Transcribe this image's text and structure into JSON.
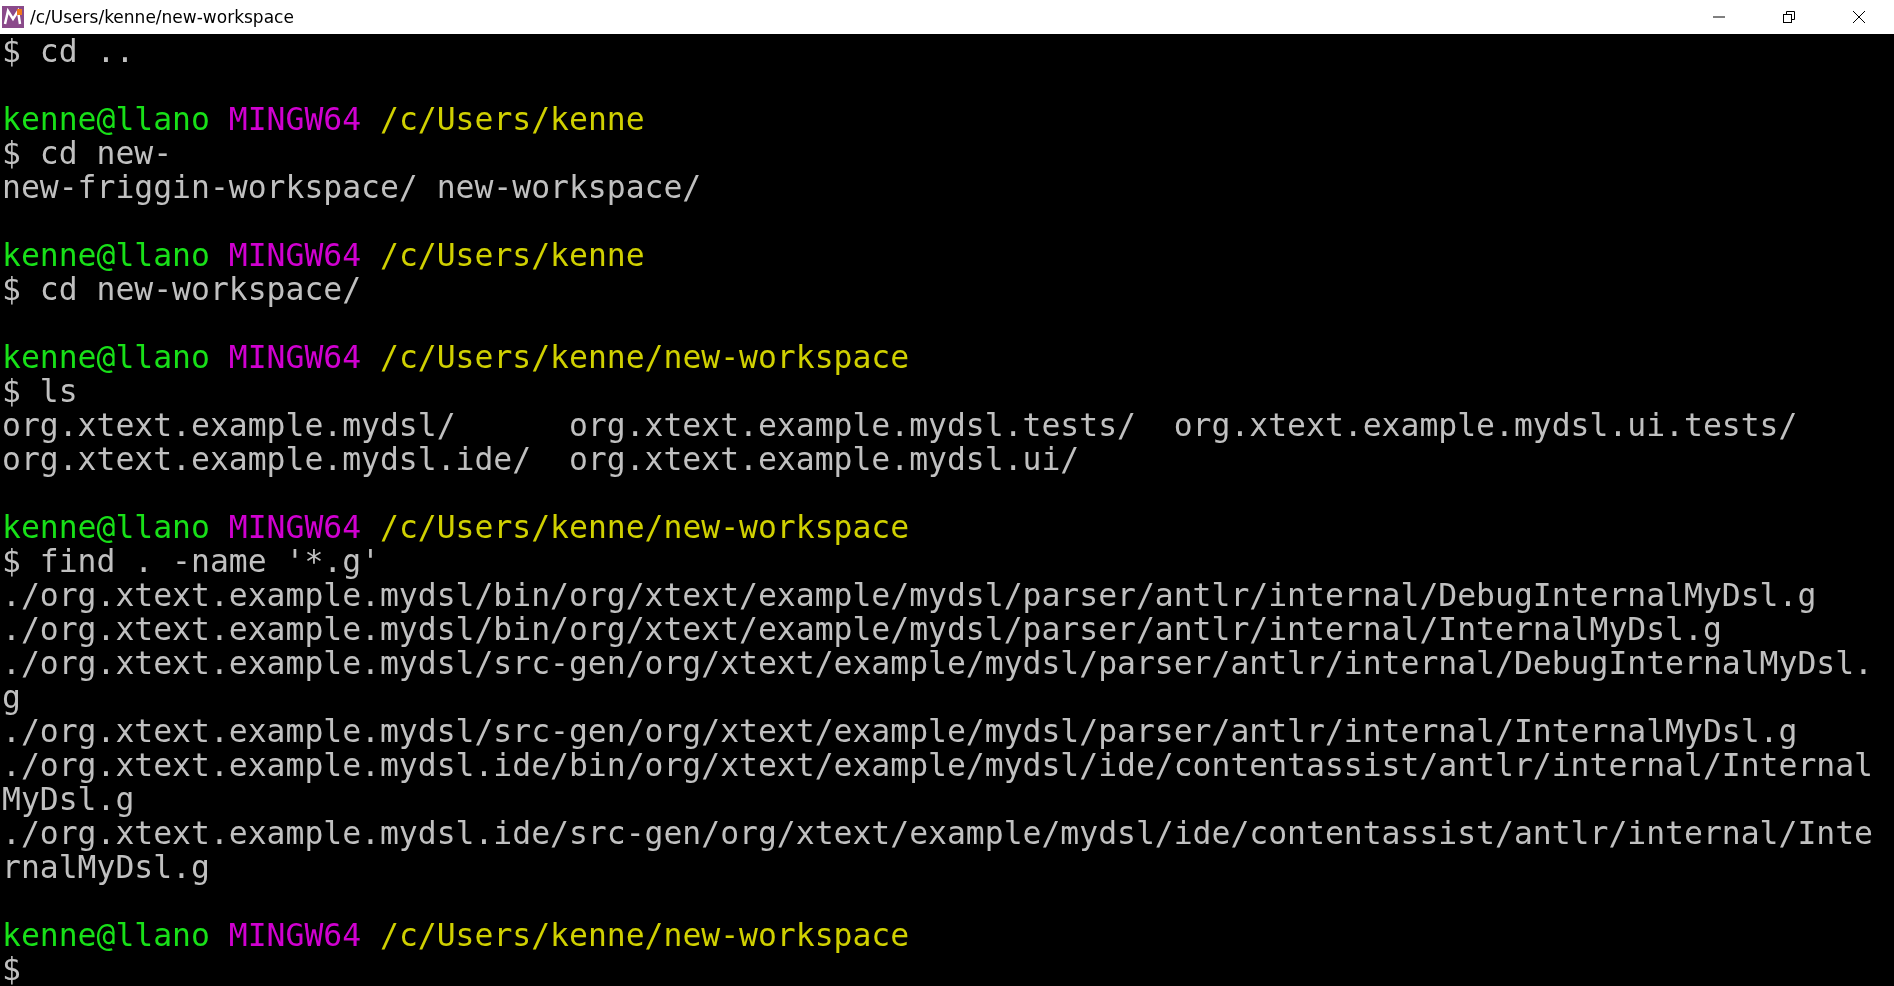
{
  "window": {
    "title": "/c/Users/kenne/new-workspace"
  },
  "lines": [
    {
      "kind": "text",
      "text": "$ cd .."
    },
    {
      "kind": "blank"
    },
    {
      "kind": "prompt",
      "user": "kenne@llano",
      "host": "MINGW64",
      "path": "/c/Users/kenne"
    },
    {
      "kind": "text",
      "text": "$ cd new-"
    },
    {
      "kind": "text",
      "text": "new-friggin-workspace/ new-workspace/"
    },
    {
      "kind": "blank"
    },
    {
      "kind": "prompt",
      "user": "kenne@llano",
      "host": "MINGW64",
      "path": "/c/Users/kenne"
    },
    {
      "kind": "text",
      "text": "$ cd new-workspace/"
    },
    {
      "kind": "blank"
    },
    {
      "kind": "prompt",
      "user": "kenne@llano",
      "host": "MINGW64",
      "path": "/c/Users/kenne/new-workspace"
    },
    {
      "kind": "text",
      "text": "$ ls"
    },
    {
      "kind": "text",
      "text": "org.xtext.example.mydsl/      org.xtext.example.mydsl.tests/  org.xtext.example.mydsl.ui.tests/"
    },
    {
      "kind": "text",
      "text": "org.xtext.example.mydsl.ide/  org.xtext.example.mydsl.ui/"
    },
    {
      "kind": "blank"
    },
    {
      "kind": "prompt",
      "user": "kenne@llano",
      "host": "MINGW64",
      "path": "/c/Users/kenne/new-workspace"
    },
    {
      "kind": "text",
      "text": "$ find . -name '*.g'"
    },
    {
      "kind": "text",
      "text": "./org.xtext.example.mydsl/bin/org/xtext/example/mydsl/parser/antlr/internal/DebugInternalMyDsl.g"
    },
    {
      "kind": "text",
      "text": "./org.xtext.example.mydsl/bin/org/xtext/example/mydsl/parser/antlr/internal/InternalMyDsl.g"
    },
    {
      "kind": "text",
      "text": "./org.xtext.example.mydsl/src-gen/org/xtext/example/mydsl/parser/antlr/internal/DebugInternalMyDsl."
    },
    {
      "kind": "text",
      "text": "g"
    },
    {
      "kind": "text",
      "text": "./org.xtext.example.mydsl/src-gen/org/xtext/example/mydsl/parser/antlr/internal/InternalMyDsl.g"
    },
    {
      "kind": "text",
      "text": "./org.xtext.example.mydsl.ide/bin/org/xtext/example/mydsl/ide/contentassist/antlr/internal/Internal"
    },
    {
      "kind": "text",
      "text": "MyDsl.g"
    },
    {
      "kind": "text",
      "text": "./org.xtext.example.mydsl.ide/src-gen/org/xtext/example/mydsl/ide/contentassist/antlr/internal/Inte"
    },
    {
      "kind": "text",
      "text": "rnalMyDsl.g"
    },
    {
      "kind": "blank"
    },
    {
      "kind": "prompt",
      "user": "kenne@llano",
      "host": "MINGW64",
      "path": "/c/Users/kenne/new-workspace"
    },
    {
      "kind": "text",
      "text": "$"
    }
  ]
}
